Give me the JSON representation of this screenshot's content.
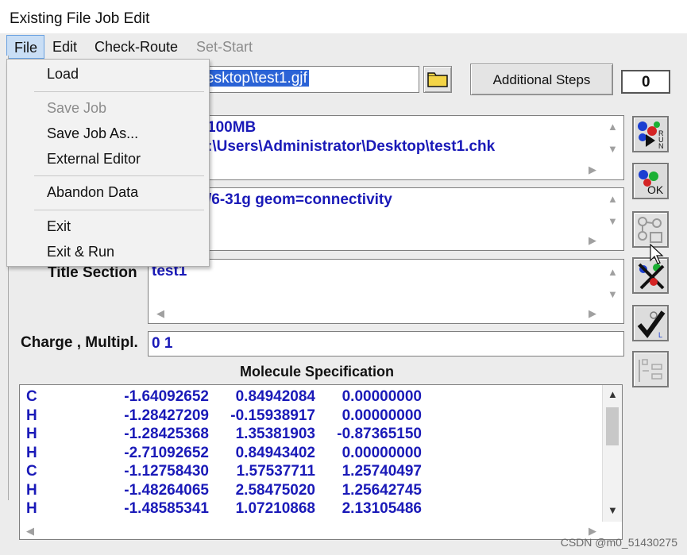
{
  "window": {
    "title": "Existing File Job Edit"
  },
  "menubar": {
    "file": "File",
    "edit": "Edit",
    "check_route": "Check-Route",
    "set_start": "Set-Start"
  },
  "file_menu": {
    "items": [
      {
        "label": "Load",
        "enabled": true
      },
      {
        "label": "Save Job",
        "enabled": false
      },
      {
        "label": "Save Job As...",
        "enabled": true
      },
      {
        "label": "External Editor",
        "enabled": true
      },
      {
        "label": "Abandon Data",
        "enabled": true
      },
      {
        "label": "Exit",
        "enabled": true
      },
      {
        "label": "Exit & Run",
        "enabled": true
      }
    ]
  },
  "file_path": {
    "value": "esktop\\test1.gjf"
  },
  "additional_steps": {
    "label": "Additional Steps",
    "count": "0"
  },
  "link0": {
    "line1": "100MB",
    "line2": ":\\Users\\Administrator\\Desktop\\test1.chk"
  },
  "route": {
    "line1": "/6-31g geom=connectivity"
  },
  "title_section": {
    "label": "Title Section",
    "value": "test1"
  },
  "charge_mult": {
    "label": "Charge , Multipl.",
    "value": "0 1"
  },
  "molecule": {
    "label": "Molecule Specification",
    "rows": [
      {
        "el": "C",
        "x": "-1.64092652",
        "y": "0.84942084",
        "z": "0.00000000"
      },
      {
        "el": "H",
        "x": "-1.28427209",
        "y": "-0.15938917",
        "z": "0.00000000"
      },
      {
        "el": "H",
        "x": "-1.28425368",
        "y": "1.35381903",
        "z": "-0.87365150"
      },
      {
        "el": "H",
        "x": "-2.71092652",
        "y": "0.84943402",
        "z": "0.00000000"
      },
      {
        "el": "C",
        "x": "-1.12758430",
        "y": "1.57537711",
        "z": "1.25740497"
      },
      {
        "el": "H",
        "x": "-1.48264065",
        "y": "2.58475020",
        "z": "1.25642745"
      },
      {
        "el": "H",
        "x": "-1.48585341",
        "y": "1.07210868",
        "z": "2.13105486"
      }
    ]
  },
  "toolbar_icons": [
    "run-icon",
    "ok-icon",
    "molecule-edit-icon",
    "cancel-icon",
    "check-icon",
    "list-icon"
  ],
  "watermark": "CSDN @m0_51430275"
}
